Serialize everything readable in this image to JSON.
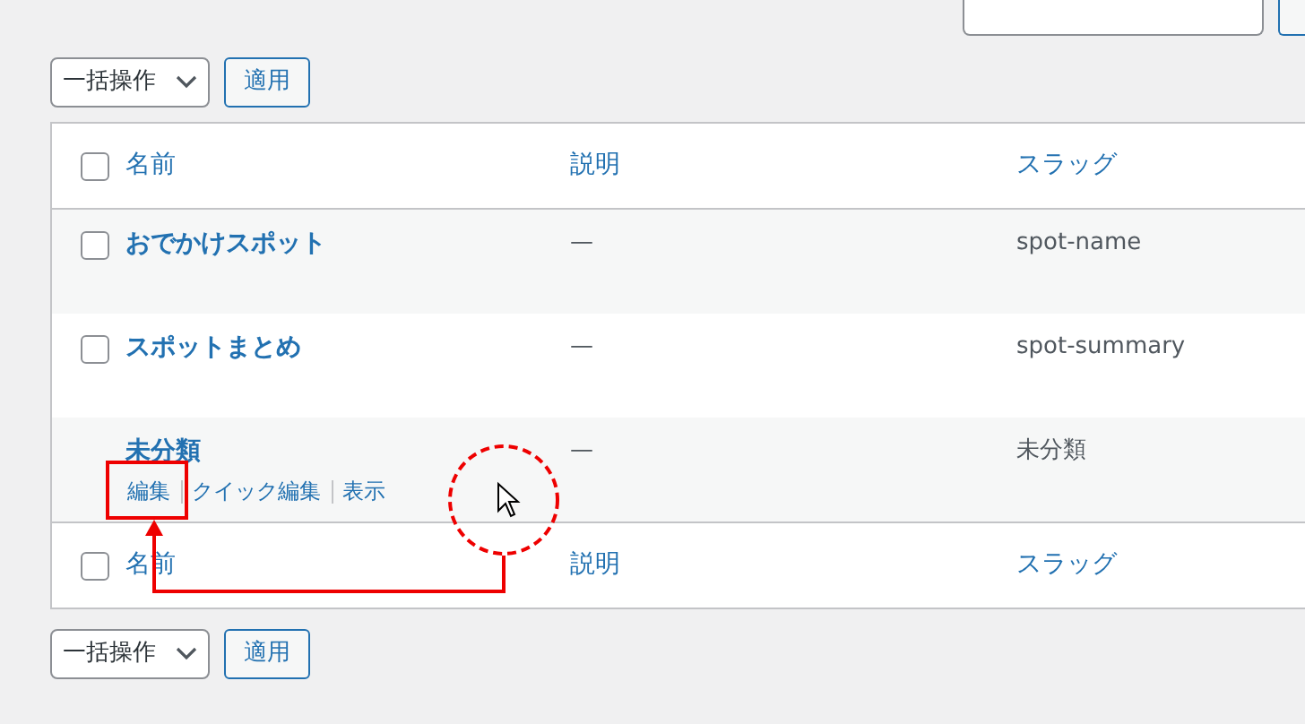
{
  "bulk_top": {
    "select": "一括操作",
    "apply": "適用"
  },
  "table": {
    "columns": [
      {
        "label": "名前"
      },
      {
        "label": "説明"
      },
      {
        "label": "スラッグ"
      }
    ],
    "header_checked": false,
    "rows": [
      {
        "name": "おでかけスポット",
        "description": "—",
        "slug": "spot-name",
        "checked": false
      },
      {
        "name": "スポットまとめ",
        "description": "—",
        "slug": "spot-summary",
        "checked": false
      },
      {
        "name": "未分類",
        "description": "—",
        "slug": "未分類",
        "actions": [
          "編集",
          "クイック編集",
          "表示"
        ]
      }
    ],
    "footer_columns": [
      {
        "label": "名前"
      },
      {
        "label": "説明"
      },
      {
        "label": "スラッグ"
      }
    ],
    "footer_checked": false
  },
  "bulk_bottom": {
    "select": "一括操作",
    "apply": "適用"
  }
}
